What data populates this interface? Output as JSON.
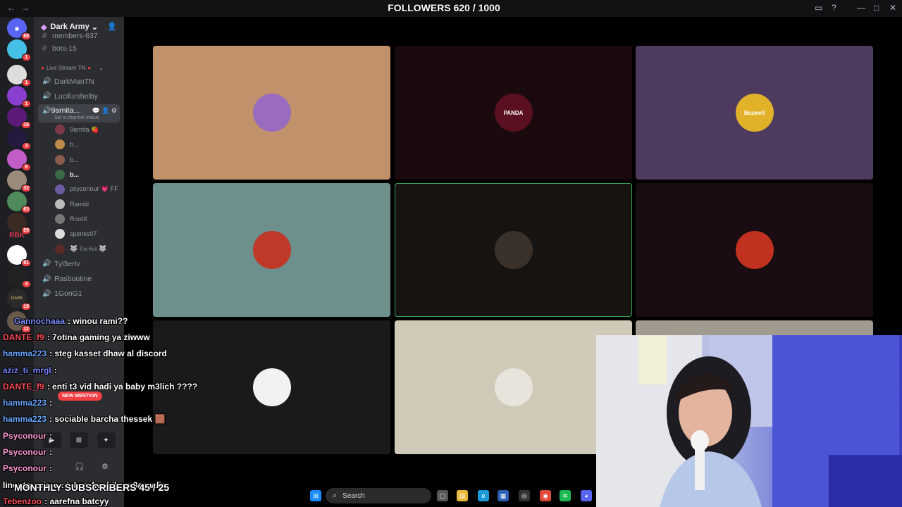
{
  "overlay": {
    "followers": "FOLLOWERS 620 / 1000",
    "monthly_subscribers": "MONTHLY SUBSCRIBERS 45 / 25"
  },
  "titlebar": {
    "back": "←",
    "forward": "→"
  },
  "server_rail": {
    "badges": [
      "68",
      "1",
      "1",
      "1",
      "16",
      "3",
      "6",
      "32",
      "63",
      "59",
      "81",
      "4",
      "18",
      "12"
    ],
    "labels": [
      "RBK",
      "DARK"
    ]
  },
  "server": {
    "name": "Dark Army",
    "text_channels": [
      "members-637",
      "bots-15"
    ],
    "category": "Live Stream TN",
    "voice_channels": [
      "DarkManTN",
      "Lucifurshelby"
    ],
    "active_channel": {
      "name": "9arnita...",
      "status": "Set a channel status",
      "members": [
        {
          "name": "9arnita 🍓",
          "bright": false
        },
        {
          "name": "b...",
          "bright": false
        },
        {
          "name": "b...",
          "bright": false
        },
        {
          "name": "b...",
          "bright": true
        },
        {
          "name": "psyconour 💗 FF",
          "bright": false
        },
        {
          "name": "Ramiiii",
          "bright": false
        },
        {
          "name": "RootX",
          "bright": false
        },
        {
          "name": "spenks07",
          "bright": false
        },
        {
          "name": "🐺 𝔏𝔲𝔠𝔦𝔣𝔲𝔯 🐺",
          "bright": false
        }
      ]
    },
    "more_channels": [
      "Tyl3ertv",
      "Rasboutine",
      "1GonG1"
    ]
  },
  "stage": {
    "tiles": [
      {
        "bg": "#c0916a",
        "avatar_bg": "#9a6cc0",
        "label": "",
        "speaking": false
      },
      {
        "bg": "#1a0a0e",
        "avatar_bg": "#5a1020",
        "label": "PANDA",
        "speaking": false
      },
      {
        "bg": "#4f3a5f",
        "avatar_bg": "#e2b12a",
        "label": "Bezwell",
        "speaking": false
      },
      {
        "bg": "#6e908c",
        "avatar_bg": "#c0392b",
        "label": "",
        "speaking": false
      },
      {
        "bg": "#161310",
        "avatar_bg": "#3a302a",
        "label": "",
        "speaking": true
      },
      {
        "bg": "#1a0d12",
        "avatar_bg": "#c0321f",
        "label": "",
        "speaking": false
      },
      {
        "bg": "#1a1a1a",
        "avatar_bg": "#f2f2f2",
        "label": "",
        "speaking": false
      },
      {
        "bg": "#cfcab8",
        "avatar_bg": "#e8e4dc",
        "label": "",
        "speaking": false
      },
      {
        "bg": "#a19a8e",
        "avatar_bg": "#a19a8e",
        "label": "",
        "speaking": false
      }
    ]
  },
  "chat": [
    {
      "user": "Gannochaaa",
      "color": "#7d8cff",
      "message": ": winou rami??"
    },
    {
      "user": "DANTE_f9",
      "color": "#ff4d5a",
      "message": ": 7otina gaming ya ziwww"
    },
    {
      "user": "hamma223",
      "color": "#6aa6ff",
      "message": ": steg kasset dhaw al discord"
    },
    {
      "user": "aziz_ti_mrgl",
      "color": "#7a86ff",
      "message": ":"
    },
    {
      "user": "DANTE_f9",
      "color": "#ff4d5a",
      "message": ": enti t3 vid hadi ya baby m3lich ????"
    },
    {
      "user": "hamma223",
      "color": "#6aa6ff",
      "message": ":"
    },
    {
      "user": "hamma223",
      "color": "#6aa6ff",
      "message": ": sociable barcha thessek 🟫"
    },
    {
      "user": "Psyconour",
      "color": "#ff9ad6",
      "message": ":"
    },
    {
      "user": "Psyconour",
      "color": "#ff9ad6",
      "message": ":"
    },
    {
      "user": "Psyconour",
      "color": "#ff9ad6",
      "message": ":"
    },
    {
      "user": "linouta_prime",
      "color": "#ffffff",
      "message": ": tcharafna bik ya 8aaaalia"
    },
    {
      "user": "Tebenzoo",
      "color": "#ff4d5a",
      "message": ": aarefna batcyy"
    }
  ],
  "new_mention": "NEW MENTION",
  "taskbar": {
    "search_placeholder": "Search"
  }
}
